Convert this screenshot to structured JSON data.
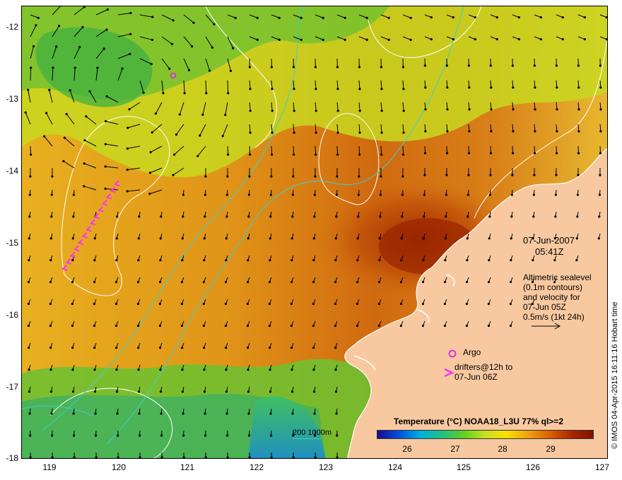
{
  "map": {
    "y_axis_labels": [
      "-12",
      "-13",
      "-14",
      "-15",
      "-16",
      "-17",
      "-18"
    ],
    "x_axis_labels": [
      "119",
      "120",
      "121",
      "122",
      "123",
      "124",
      "125",
      "126",
      "127"
    ],
    "lon_range": [
      118.6,
      127.0
    ],
    "lat_range": [
      -18.0,
      -11.7
    ],
    "colors": {
      "land": "#f8c9a0",
      "coast": "#ffffff",
      "isobath": "#3ccfcf",
      "sealevel_contour": "#ffffff",
      "argo": "#e020e0",
      "drifter": "#ff30ff",
      "velocity_arrow": "#000000"
    }
  },
  "annotations": {
    "date": "07-Jun-2007",
    "time": "05:41Z",
    "altimetry_lines": [
      "Altimetric sealevel",
      "(0.1m contours)",
      "and velocity for",
      "07-Jun 05Z",
      "0.5m/s (1kt 24h)"
    ],
    "argo_label": "Argo",
    "drifter_lines": [
      "drifters@12h to",
      "07-Jun 06Z"
    ],
    "credit": "© IMOS 04-Apr-2015 16:11:16 Hobart time"
  },
  "colorbar": {
    "title": "Temperature (°C) NOAA18_L3U 77% ql>=2",
    "ticks": [
      "26",
      "27",
      "28",
      "29"
    ],
    "colors": [
      "#1a0a8c",
      "#0050e0",
      "#00b0e0",
      "#20c080",
      "#60d020",
      "#c8e020",
      "#f8e000",
      "#f0a010",
      "#d86000",
      "#a82800",
      "#801000"
    ]
  },
  "isobath_legend": {
    "label": "200  1000m"
  }
}
